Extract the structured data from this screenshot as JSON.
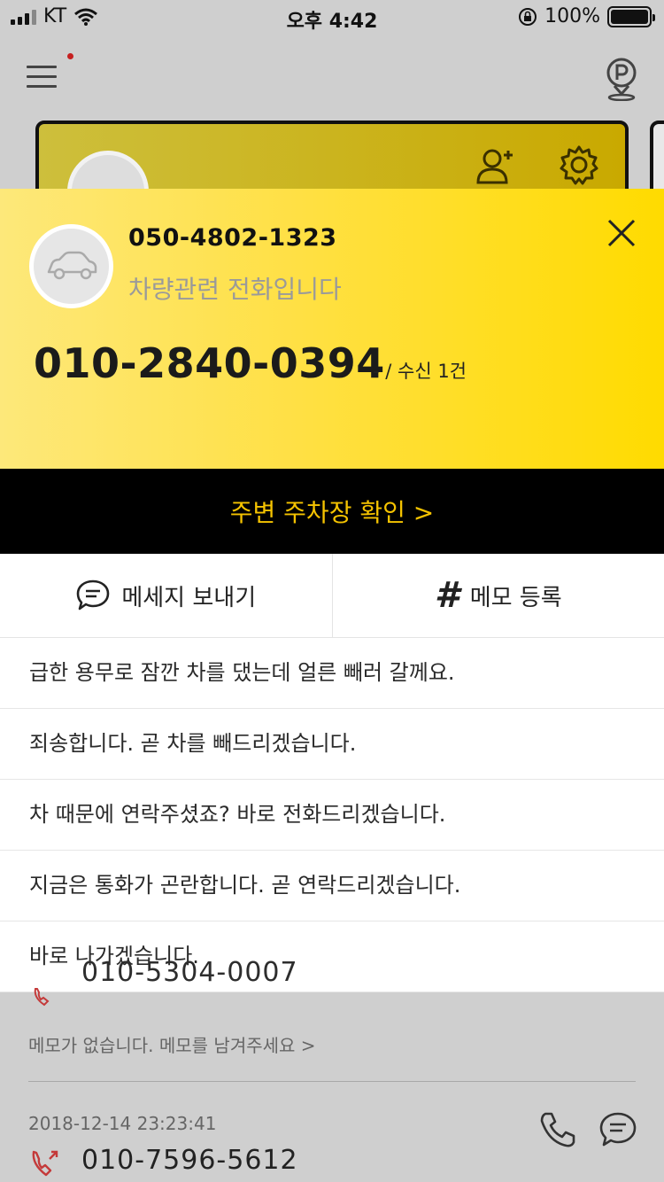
{
  "status_bar": {
    "carrier": "KT",
    "time": "오후 4:42",
    "battery": "100%"
  },
  "popup": {
    "caller_number": "050-4802-1323",
    "caller_description": "차량관련 전화입니다",
    "phone_number": "010-2840-0394",
    "phone_meta": "- / 수신 1건"
  },
  "banner": {
    "label": "주변 주차장 확인 >"
  },
  "actions": {
    "message_label": "메세지 보내기",
    "memo_label": "메모 등록"
  },
  "messages": [
    "급한 용무로 잠깐 차를 댔는데 얼른 빼러 갈께요.",
    "죄송합니다. 곧 차를 빼드리겠습니다.",
    "차 때문에 연락주셨죠? 바로 전화드리겠습니다.",
    "지금은 통화가 곤란합니다. 곧 연락드리겠습니다.",
    "바로 나가겠습니다."
  ],
  "background": {
    "peek_number": "010-5304-0007",
    "memo_empty": "메모가 없습니다. 메모를 남겨주세요 >",
    "log_time": "2018-12-14 23:23:41",
    "log_number": "010-7596-5612"
  },
  "colors": {
    "accent_yellow": "#ffdb00",
    "banner_text": "#f5c300",
    "banner_bg": "#000000"
  },
  "icons": [
    "menu-icon",
    "parking-location-icon",
    "add-user-icon",
    "gear-icon",
    "car-icon",
    "close-icon",
    "chat-bubble-icon",
    "hash-icon",
    "call-log-icon",
    "phone-icon"
  ]
}
